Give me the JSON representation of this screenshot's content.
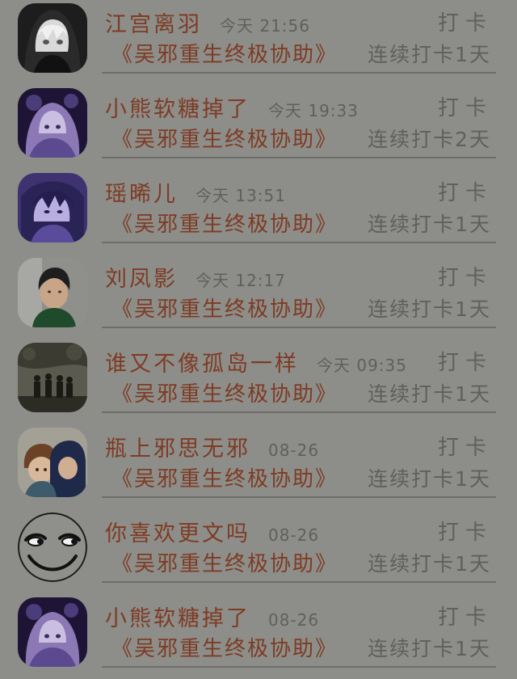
{
  "checkin_label": "打卡",
  "topic": "《吴邪重生终极协助》",
  "colors": {
    "background": "#8d8e89",
    "name_text": "#7e3b24",
    "muted_text": "#5f605b",
    "divider": "#6d6e69"
  },
  "items": [
    {
      "name": "江宫离羽",
      "time": "今天 21:56",
      "streak": "连续打卡1天",
      "avatar_icon": "anime-boy-hood-avatar"
    },
    {
      "name": "小熊软糖掉了",
      "time": "今天 19:33",
      "streak": "连续打卡2天",
      "avatar_icon": "purple-anime-girl-avatar"
    },
    {
      "name": "瑶晞儿",
      "time": "今天 13:51",
      "streak": "连续打卡1天",
      "avatar_icon": "purple-anime-boy-avatar"
    },
    {
      "name": "刘凤影",
      "time": "今天 12:17",
      "streak": "连续打卡1天",
      "avatar_icon": "boy-photo-avatar"
    },
    {
      "name": "谁又不像孤岛一样",
      "time": "今天 09:35",
      "streak": "连续打卡1天",
      "avatar_icon": "group-silhouette-avatar"
    },
    {
      "name": "瓶上邪思无邪",
      "time": "08-26",
      "streak": "连续打卡1天",
      "avatar_icon": "chibi-couple-avatar"
    },
    {
      "name": "你喜欢更文吗",
      "time": "08-26",
      "streak": "连续打卡1天",
      "avatar_icon": "smirk-face-avatar"
    },
    {
      "name": "小熊软糖掉了",
      "time": "08-26",
      "streak": "连续打卡1天",
      "avatar_icon": "purple-anime-girl-avatar"
    }
  ]
}
